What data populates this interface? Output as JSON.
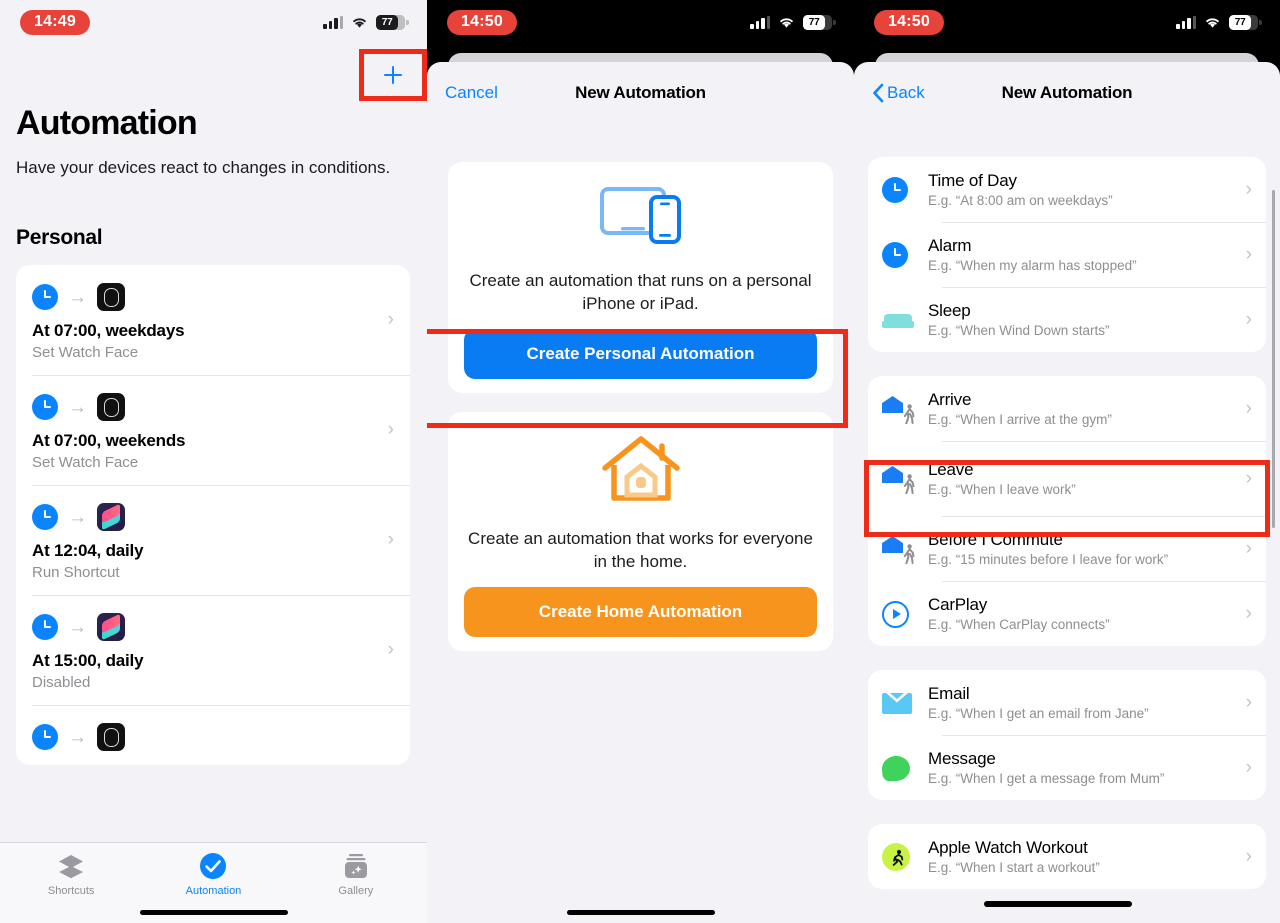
{
  "left": {
    "status": {
      "time": "14:49",
      "battery": "77"
    },
    "add_button": "+",
    "title": "Automation",
    "subtitle": "Have your devices react to changes in conditions.",
    "section": "Personal",
    "rows": [
      {
        "title": "At 07:00, weekdays",
        "sub": "Set Watch Face",
        "app": "watch"
      },
      {
        "title": "At 07:00, weekends",
        "sub": "Set Watch Face",
        "app": "watch"
      },
      {
        "title": "At 12:04, daily",
        "sub": "Run Shortcut",
        "app": "shortcuts"
      },
      {
        "title": "At 15:00, daily",
        "sub": "Disabled",
        "app": "shortcuts"
      }
    ],
    "tabs": [
      {
        "label": "Shortcuts",
        "icon": "layers-icon",
        "active": false
      },
      {
        "label": "Automation",
        "icon": "check-circle-icon",
        "active": true
      },
      {
        "label": "Gallery",
        "icon": "gallery-icon",
        "active": false
      }
    ]
  },
  "middle": {
    "status": {
      "time": "14:50",
      "battery": "77"
    },
    "nav": {
      "cancel": "Cancel",
      "title": "New Automation"
    },
    "personal": {
      "icon": "devices-icon",
      "description": "Create an automation that runs on a personal iPhone or iPad.",
      "button": "Create Personal Automation",
      "button_color": "#0a7cf3"
    },
    "home": {
      "icon": "house-icon",
      "description": "Create an automation that works for everyone in the home.",
      "button": "Create Home Automation",
      "button_color": "#f7941d"
    }
  },
  "right": {
    "status": {
      "time": "14:50",
      "battery": "77"
    },
    "nav": {
      "back": "Back",
      "title": "New Automation"
    },
    "groups": [
      {
        "items": [
          {
            "title": "Time of Day",
            "sub": "E.g. “At 8:00 am on weekdays”",
            "icon": "clock-icon"
          },
          {
            "title": "Alarm",
            "sub": "E.g. “When my alarm has stopped”",
            "icon": "clock-icon"
          },
          {
            "title": "Sleep",
            "sub": "E.g. “When Wind Down starts”",
            "icon": "bed-icon"
          }
        ]
      },
      {
        "items": [
          {
            "title": "Arrive",
            "sub": "E.g. “When I arrive at the gym”",
            "icon": "house-walk-icon"
          },
          {
            "title": "Leave",
            "sub": "E.g. “When I leave work”",
            "icon": "house-walk-icon",
            "highlighted": true
          },
          {
            "title": "Before I Commute",
            "sub": "E.g. “15 minutes before I leave for work”",
            "icon": "house-walk-icon"
          },
          {
            "title": "CarPlay",
            "sub": "E.g. “When CarPlay connects”",
            "icon": "carplay-icon"
          }
        ]
      },
      {
        "items": [
          {
            "title": "Email",
            "sub": "E.g. “When I get an email from Jane”",
            "icon": "mail-icon"
          },
          {
            "title": "Message",
            "sub": "E.g. “When I get a message from Mum”",
            "icon": "message-icon"
          }
        ]
      },
      {
        "items": [
          {
            "title": "Apple Watch Workout",
            "sub": "E.g. “When I start a workout”",
            "icon": "workout-icon"
          }
        ]
      }
    ]
  },
  "highlight_color": "#ee2a18"
}
